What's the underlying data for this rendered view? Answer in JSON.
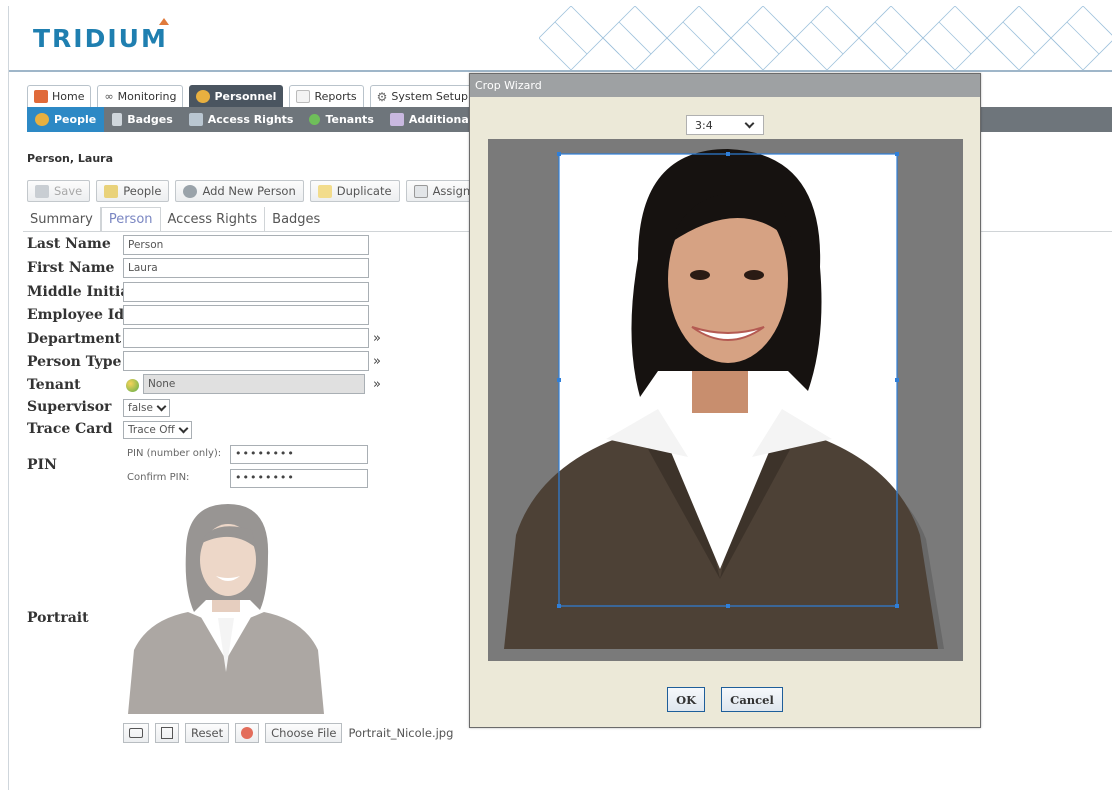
{
  "brand": {
    "logo_text": "TRIDIUM"
  },
  "main_tabs": [
    {
      "label": "Home",
      "icon": "home-icon"
    },
    {
      "label": "Monitoring",
      "icon": "binoculars-icon"
    },
    {
      "label": "Personnel",
      "icon": "people-icon",
      "active": true
    },
    {
      "label": "Reports",
      "icon": "report-icon"
    },
    {
      "label": "System Setup",
      "icon": "gear-icon"
    }
  ],
  "sub_nav": [
    {
      "label": "People",
      "icon": "people-icon",
      "active": true
    },
    {
      "label": "Badges",
      "icon": "badge-icon"
    },
    {
      "label": "Access Rights",
      "icon": "access-icon"
    },
    {
      "label": "Tenants",
      "icon": "tenant-icon"
    },
    {
      "label": "Additional Pers",
      "icon": "list-icon"
    }
  ],
  "person": {
    "name": "Person, Laura"
  },
  "toolbar": {
    "save": "Save",
    "people": "People",
    "add_new_person": "Add New Person",
    "duplicate": "Duplicate",
    "assign_new": "Assign Nev"
  },
  "sub_tabs": [
    "Summary",
    "Person",
    "Access Rights",
    "Badges"
  ],
  "form": {
    "last_name_label": "Last Name",
    "last_name_value": "Person",
    "first_name_label": "First Name",
    "first_name_value": "Laura",
    "middle_initial_label": "Middle Initial",
    "middle_initial_value": "",
    "employee_id_label": "Employee Id",
    "employee_id_value": "",
    "department_label": "Department",
    "department_value": "",
    "person_type_label": "Person Type",
    "person_type_value": "",
    "tenant_label": "Tenant",
    "tenant_value": "None",
    "supervisor_label": "Supervisor",
    "supervisor_value": "false",
    "trace_card_label": "Trace Card",
    "trace_card_value": "Trace Off",
    "pin_label": "PIN",
    "pin_number_label": "PIN (number only):",
    "pin_value": "••••••••",
    "confirm_pin_label": "Confirm PIN:",
    "confirm_pin_value": "••••••••",
    "portrait_label": "Portrait",
    "more_symbol": "»"
  },
  "portrait_tools": {
    "reset": "Reset",
    "choose_file": "Choose File",
    "file_name": "Portrait_Nicole.jpg"
  },
  "crop_wizard": {
    "title": "Crop Wizard",
    "ratio": "3:4",
    "ok": "OK",
    "cancel": "Cancel"
  },
  "colors": {
    "accent_blue": "#2d89c5",
    "subnav_gray": "#6e757b",
    "dialog_bg": "#ece9d8"
  }
}
